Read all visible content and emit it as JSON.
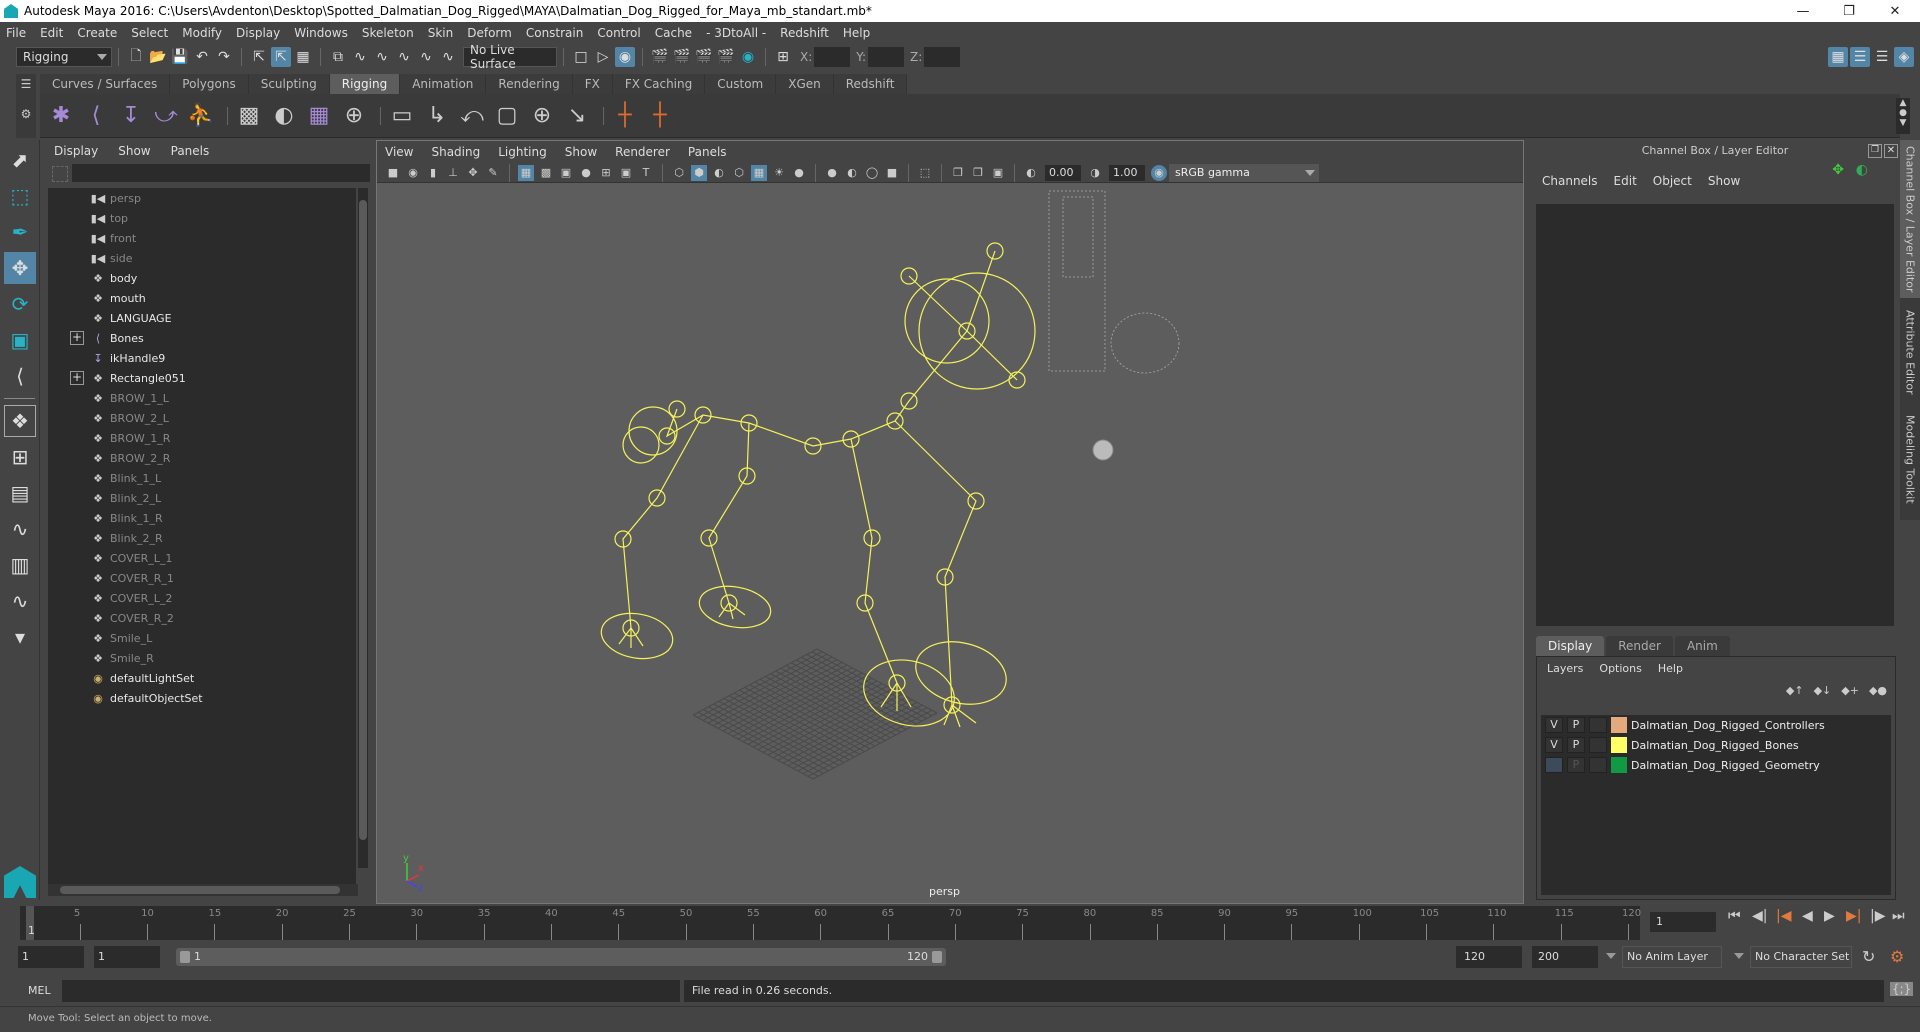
{
  "window": {
    "title": "Autodesk Maya 2016: C:\\Users\\Avdenton\\Desktop\\Spotted_Dalmatian_Dog_Rigged\\MAYA\\Dalmatian_Dog_Rigged_for_Maya_mb_standart.mb*",
    "minimize_icon": "minimize-icon",
    "restore_icon": "restore-icon",
    "close_icon": "close-icon"
  },
  "menubar": [
    "File",
    "Edit",
    "Create",
    "Select",
    "Modify",
    "Display",
    "Windows",
    "Skeleton",
    "Skin",
    "Deform",
    "Constrain",
    "Control",
    "Cache",
    "- 3DtoAll -",
    "Redshift",
    "Help"
  ],
  "toolbar": {
    "menuset": "Rigging",
    "live_surface": "No Live Surface",
    "x_label": "X:",
    "y_label": "Y:",
    "z_label": "Z:"
  },
  "shelf": {
    "tabs": [
      "Curves / Surfaces",
      "Polygons",
      "Sculpting",
      "Rigging",
      "Animation",
      "Rendering",
      "FX",
      "FX Caching",
      "Custom",
      "XGen",
      "Redshift"
    ],
    "active_tab": "Rigging"
  },
  "outliner": {
    "menu": [
      "Display",
      "Show",
      "Panels"
    ],
    "items": [
      {
        "label": "persp",
        "icon": "camera-icon",
        "style": "dim",
        "expandable": false
      },
      {
        "label": "top",
        "icon": "camera-icon",
        "style": "dim",
        "expandable": false
      },
      {
        "label": "front",
        "icon": "camera-icon",
        "style": "dim",
        "expandable": false
      },
      {
        "label": "side",
        "icon": "camera-icon",
        "style": "dim",
        "expandable": false
      },
      {
        "label": "body",
        "icon": "mesh-icon",
        "style": "bright",
        "expandable": false
      },
      {
        "label": "mouth",
        "icon": "mesh-icon",
        "style": "bright",
        "expandable": false
      },
      {
        "label": "LANGUAGE",
        "icon": "mesh-icon",
        "style": "bright",
        "expandable": false
      },
      {
        "label": "Bones",
        "icon": "joint-icon",
        "style": "bright",
        "expandable": true
      },
      {
        "label": "ikHandle9",
        "icon": "ik-handle-icon",
        "style": "bright",
        "expandable": false
      },
      {
        "label": "Rectangle051",
        "icon": "mesh-icon",
        "style": "bright",
        "expandable": true
      },
      {
        "label": "BROW_1_L",
        "icon": "mesh-icon",
        "style": "dim",
        "expandable": false
      },
      {
        "label": "BROW_2_L",
        "icon": "mesh-icon",
        "style": "dim",
        "expandable": false
      },
      {
        "label": "BROW_1_R",
        "icon": "mesh-icon",
        "style": "dim",
        "expandable": false
      },
      {
        "label": "BROW_2_R",
        "icon": "mesh-icon",
        "style": "dim",
        "expandable": false
      },
      {
        "label": "Blink_1_L",
        "icon": "mesh-icon",
        "style": "dim",
        "expandable": false
      },
      {
        "label": "Blink_2_L",
        "icon": "mesh-icon",
        "style": "dim",
        "expandable": false
      },
      {
        "label": "Blink_1_R",
        "icon": "mesh-icon",
        "style": "dim",
        "expandable": false
      },
      {
        "label": "Blink_2_R",
        "icon": "mesh-icon",
        "style": "dim",
        "expandable": false
      },
      {
        "label": "COVER_L_1",
        "icon": "mesh-icon",
        "style": "dim",
        "expandable": false
      },
      {
        "label": "COVER_R_1",
        "icon": "mesh-icon",
        "style": "dim",
        "expandable": false
      },
      {
        "label": "COVER_L_2",
        "icon": "mesh-icon",
        "style": "dim",
        "expandable": false
      },
      {
        "label": "COVER_R_2",
        "icon": "mesh-icon",
        "style": "dim",
        "expandable": false
      },
      {
        "label": "Smile_L",
        "icon": "mesh-icon",
        "style": "dim",
        "expandable": false
      },
      {
        "label": "Smile_R",
        "icon": "mesh-icon",
        "style": "dim",
        "expandable": false
      },
      {
        "label": "defaultLightSet",
        "icon": "set-icon",
        "style": "bright",
        "expandable": false
      },
      {
        "label": "defaultObjectSet",
        "icon": "set-icon",
        "style": "bright",
        "expandable": false
      }
    ]
  },
  "viewport": {
    "menu": [
      "View",
      "Shading",
      "Lighting",
      "Show",
      "Renderer",
      "Panels"
    ],
    "exposure": "0.00",
    "gamma": "1.00",
    "color_space": "sRGB gamma",
    "camera_label": "persp",
    "axis": {
      "x": "x",
      "y": "y",
      "z": "z"
    },
    "wire_color": "#f5f25a"
  },
  "channelbox": {
    "title": "Channel Box / Layer Editor",
    "menu": [
      "Channels",
      "Edit",
      "Object",
      "Show"
    ],
    "layer_tabs": [
      "Display",
      "Render",
      "Anim"
    ],
    "active_layer_tab": "Display",
    "layer_menu": [
      "Layers",
      "Options",
      "Help"
    ],
    "layers": [
      {
        "v": "V",
        "p": "P",
        "name": "Dalmatian_Dog_Rigged_Controllers",
        "color": "#e4aa7c",
        "visible": true
      },
      {
        "v": "V",
        "p": "P",
        "name": "Dalmatian_Dog_Rigged_Bones",
        "color": "#ffff66",
        "visible": true
      },
      {
        "v": "",
        "p": "P",
        "name": "Dalmatian_Dog_Rigged_Geometry",
        "color": "#119944",
        "visible": false
      }
    ]
  },
  "side_tabs": [
    "Channel Box / Layer Editor",
    "Attribute Editor",
    "Modeling Toolkit"
  ],
  "timeline": {
    "ticks": [
      5,
      10,
      15,
      20,
      25,
      30,
      35,
      40,
      45,
      50,
      55,
      60,
      65,
      70,
      75,
      80,
      85,
      90,
      95,
      100,
      105,
      110,
      115,
      120
    ],
    "start": 1,
    "end": 120,
    "current_frame": "1",
    "current_label": "1"
  },
  "range": {
    "start_time": "1",
    "playback_start": "1",
    "slider_start": "1",
    "slider_end": "120",
    "playback_end": "120",
    "end_time": "200",
    "anim_layer": "No Anim Layer",
    "character_set": "No Character Set"
  },
  "command": {
    "lang": "MEL",
    "result": "File read in  0.26 seconds."
  },
  "status": {
    "help_line": "Move Tool: Select an object to move."
  }
}
